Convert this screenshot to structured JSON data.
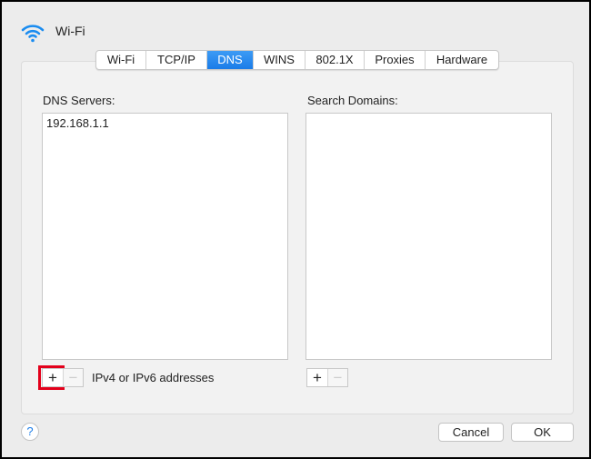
{
  "window": {
    "title": "Wi-Fi",
    "icon": "wifi-icon"
  },
  "tabs": [
    {
      "label": "Wi-Fi"
    },
    {
      "label": "TCP/IP"
    },
    {
      "label": "DNS",
      "active": true
    },
    {
      "label": "WINS"
    },
    {
      "label": "802.1X"
    },
    {
      "label": "Proxies"
    },
    {
      "label": "Hardware"
    }
  ],
  "dns": {
    "label": "DNS Servers:",
    "items": [
      "192.168.1.1"
    ],
    "hint": "IPv4 or IPv6 addresses",
    "add": "+",
    "remove": "−"
  },
  "search": {
    "label": "Search Domains:",
    "items": [],
    "add": "+",
    "remove": "−"
  },
  "footer": {
    "help": "?",
    "cancel": "Cancel",
    "ok": "OK"
  },
  "colors": {
    "accent": "#1a7ce8",
    "highlight": "#e3001b"
  }
}
